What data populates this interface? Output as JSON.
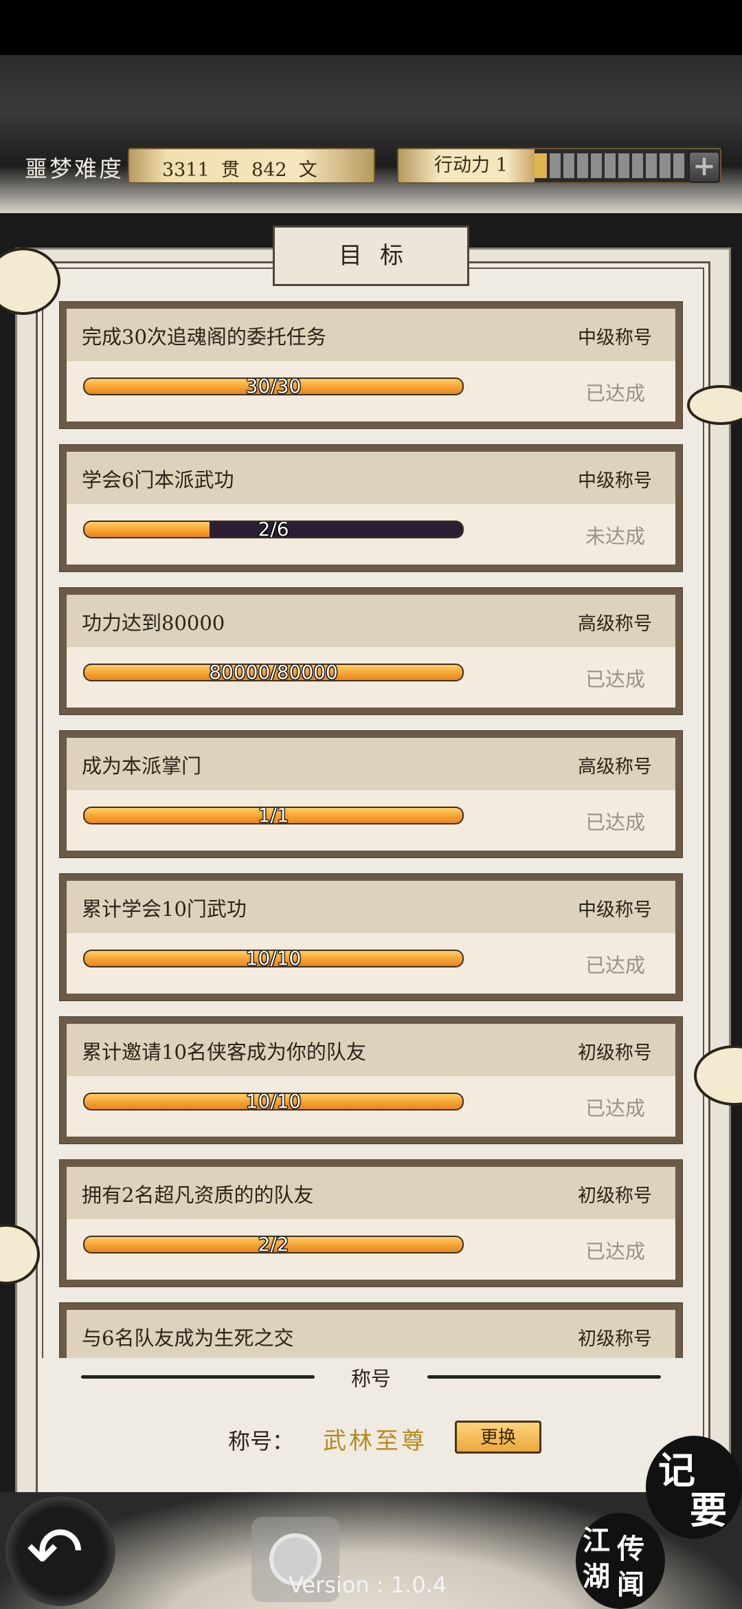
{
  "header": {
    "difficulty": "噩梦难度",
    "money_text": "3311  贯  842  文",
    "action_points_label": "行动力 1",
    "action_points_value": 1,
    "action_points_segments": 10
  },
  "panel": {
    "title": "目标"
  },
  "tasks": [
    {
      "name": "完成30次追魂阁的委托任务",
      "rank": "中级称号",
      "progress": "30/30",
      "fraction": 1.0,
      "status": "已达成"
    },
    {
      "name": "学会6门本派武功",
      "rank": "中级称号",
      "progress": "2/6",
      "fraction": 0.333,
      "status": "未达成"
    },
    {
      "name": "功力达到80000",
      "rank": "高级称号",
      "progress": "80000/80000",
      "fraction": 1.0,
      "status": "已达成"
    },
    {
      "name": "成为本派掌门",
      "rank": "高级称号",
      "progress": "1/1",
      "fraction": 1.0,
      "status": "已达成"
    },
    {
      "name": "累计学会10门武功",
      "rank": "中级称号",
      "progress": "10/10",
      "fraction": 1.0,
      "status": "已达成"
    },
    {
      "name": "累计邀请10名侠客成为你的队友",
      "rank": "初级称号",
      "progress": "10/10",
      "fraction": 1.0,
      "status": "已达成"
    },
    {
      "name": "拥有2名超凡资质的的队友",
      "rank": "初级称号",
      "progress": "2/2",
      "fraction": 1.0,
      "status": "已达成"
    },
    {
      "name": "与6名队友成为生死之交",
      "rank": "初级称号",
      "progress": "",
      "fraction": 0,
      "status": ""
    }
  ],
  "title_section": {
    "heading": "称号",
    "label": "称号：",
    "value": "武林至尊",
    "change_button": "更换"
  },
  "nav": {
    "notes_button": [
      "记",
      "要"
    ],
    "rumors_button": [
      "江",
      "湖",
      "传",
      "闻"
    ],
    "version": "Version : 1.0.4"
  },
  "colors": {
    "progress_fill": "#f7a233",
    "title_value": "#b78a1c",
    "status_gray": "#9a9285"
  }
}
